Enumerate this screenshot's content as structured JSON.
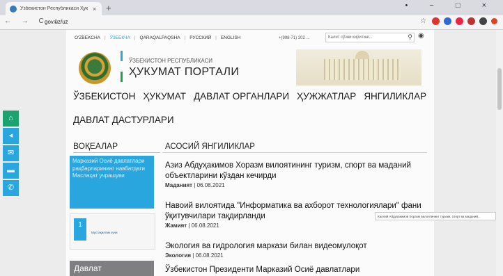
{
  "browser": {
    "tab_title": "Ўзбекистон Республикаси Ҳук",
    "tab_close": "×",
    "new_tab": "+",
    "window_controls": "• − □ ×",
    "nav_buttons": "← → C ⌂",
    "url": "gov.uz/uz"
  },
  "site": {
    "languages": [
      "O'ZBEKCHA",
      "ЎЗБЕКЧА",
      "QARAQALPAQSHA",
      "РУССКИЙ",
      "ENGLISH"
    ],
    "selected_language": "ЎЗБЕКЧА",
    "phone": "+(998-71) 202 ...",
    "search_placeholder": "Калит сўзни киритинг...",
    "header_line1": "ЎЗБЕКИСТОН РЕСПУБЛИКАСИ",
    "header_line2": "ҲУКУМАТ ПОРТАЛИ",
    "menu": [
      "ЎЗБЕКИСТОН",
      "ҲУКУМАТ",
      "ДАВЛАТ ОРГАНЛАРИ",
      "ҲУЖЖАТЛАР",
      "ЯНГИЛИКЛАР"
    ],
    "menu2": "ДАВЛАТ ДАСТУРЛАРИ",
    "events_title": "ВОҚЕАЛАР",
    "event_card": "Марказий Осиё давлатлари раҳбарларининг навбатдаги Маслаҳат учрашуви",
    "day_number": "1",
    "day_label": "Мустақиллик куни",
    "card3_title": "Давлат",
    "news_title": "АСОСИЙ ЯНГИЛИКЛАР",
    "news": [
      {
        "headline": "Азиз Абдуҳакимов Хоразм вилоятининг туризм, спорт ва маданий объектларини кўздан кечирди",
        "category": "Маданият",
        "date": "06.08.2021"
      },
      {
        "headline": "Навоий вилоятида \"Информатика ва ахборот технологиялари\" фани ўқитувчилари тақдирланди",
        "category": "Жамият",
        "date": "06.08.2021"
      },
      {
        "headline": "Экология ва гидрология маркази билан видеомулоқот",
        "category": "Экология",
        "date": "06.08.2021"
      },
      {
        "headline": "Ўзбекистон Президенти Марказий Осиё давлатлари",
        "category": "",
        "date": ""
      }
    ],
    "tooltip": "Каллий Абдуҳакимов Хоразм вилоятининг туризм, спорт ва маданий..."
  },
  "sidebar_icons": [
    "home-icon",
    "share-icon",
    "mail-icon",
    "chat-icon",
    "phone-icon"
  ]
}
